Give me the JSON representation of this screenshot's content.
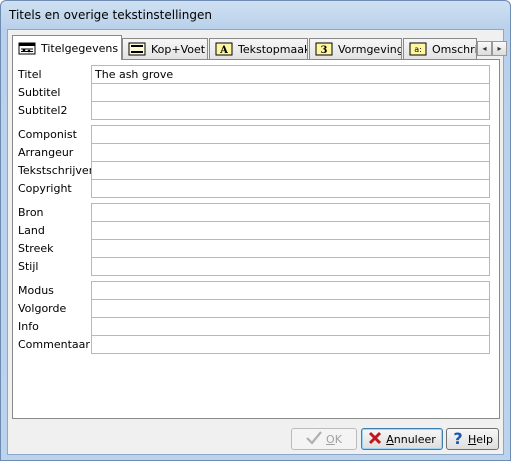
{
  "window": {
    "title": "Titels en overige tekstinstellingen"
  },
  "tabs": [
    {
      "label": "Titelgegevens",
      "icon": "score-icon",
      "active": true
    },
    {
      "label": "Kop+Voet",
      "icon": "header-footer-icon",
      "active": false
    },
    {
      "label": "Tekstopmaak",
      "icon": "text-format-icon",
      "active": false
    },
    {
      "label": "Vormgeving",
      "icon": "layout-icon",
      "active": false
    },
    {
      "label": "Omschrij",
      "icon": "description-icon",
      "active": false
    }
  ],
  "tab_scroll": {
    "left": "◂",
    "right": "▸"
  },
  "fields": [
    {
      "label": "Titel",
      "value": "The ash grove"
    },
    {
      "label": "Subtitel",
      "value": ""
    },
    {
      "label": "Subtitel2",
      "value": ""
    },
    {
      "label": "Componist",
      "value": ""
    },
    {
      "label": "Arrangeur",
      "value": ""
    },
    {
      "label": "Tekstschrijver",
      "value": ""
    },
    {
      "label": "Copyright",
      "value": ""
    },
    {
      "label": "Bron",
      "value": ""
    },
    {
      "label": "Land",
      "value": ""
    },
    {
      "label": "Streek",
      "value": ""
    },
    {
      "label": "Stijl",
      "value": ""
    },
    {
      "label": "Modus",
      "value": ""
    },
    {
      "label": "Volgorde",
      "value": ""
    },
    {
      "label": "Info",
      "value": ""
    },
    {
      "label": "Commentaar",
      "value": ""
    }
  ],
  "buttons": {
    "ok": {
      "label_prefix": "O",
      "label_rest": "K",
      "enabled": false
    },
    "cancel": {
      "label_prefix": "A",
      "label_rest": "nnuleer"
    },
    "help": {
      "label_prefix": "H",
      "label_rest": "elp"
    }
  },
  "colors": {
    "cancel_icon": "#c0191b",
    "help_icon": "#1b56b3",
    "ok_icon_disabled": "#b0b0b0"
  }
}
